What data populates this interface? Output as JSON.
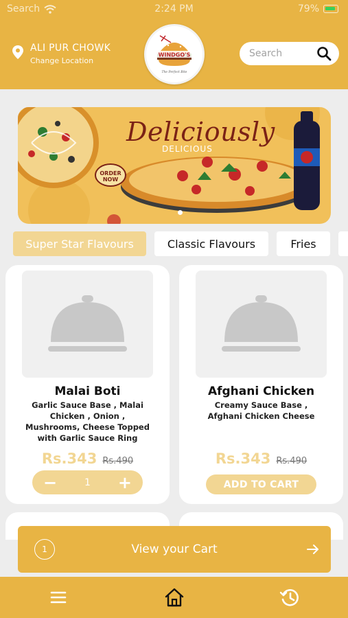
{
  "status_bar": {
    "carrier": "Search",
    "time": "2:24 PM",
    "battery": "79%"
  },
  "header": {
    "location_title": "ALI PUR CHOWK",
    "location_sub": "Change Location",
    "logo_text": "WINDGO'S",
    "logo_tagline": "The Perfect Bite",
    "search_placeholder": "Search"
  },
  "banner": {
    "title": "Deliciously",
    "subtitle": "DELICIOUS",
    "badge_line1": "ORDER",
    "badge_line2": "NOW"
  },
  "tabs": [
    "Super Star Flavours",
    "Classic Flavours",
    "Fries"
  ],
  "products": [
    {
      "name": "Malai Boti",
      "description": "Garlic Sauce Base  , Malai Chicken , Onion , Mushrooms, Cheese Topped with  Garlic Sauce Ring",
      "price": "Rs.343",
      "old_price": "Rs.490",
      "quantity": "1"
    },
    {
      "name": "Afghani Chicken",
      "description": "Creamy Sauce Base  , Afghani Chicken Cheese",
      "price": "Rs.343",
      "old_price": "Rs.490",
      "button": "ADD TO CART"
    }
  ],
  "cart": {
    "count": "1",
    "label": "View your Cart"
  },
  "colors": {
    "brand": "#e8b444",
    "accent_light": "#f2d693",
    "background": "#ededed"
  },
  "icons": [
    "wifi-icon",
    "battery-icon",
    "location-pin-icon",
    "search-icon",
    "cloche-icon",
    "arrow-right-icon",
    "menu-icon",
    "home-icon",
    "history-icon"
  ]
}
